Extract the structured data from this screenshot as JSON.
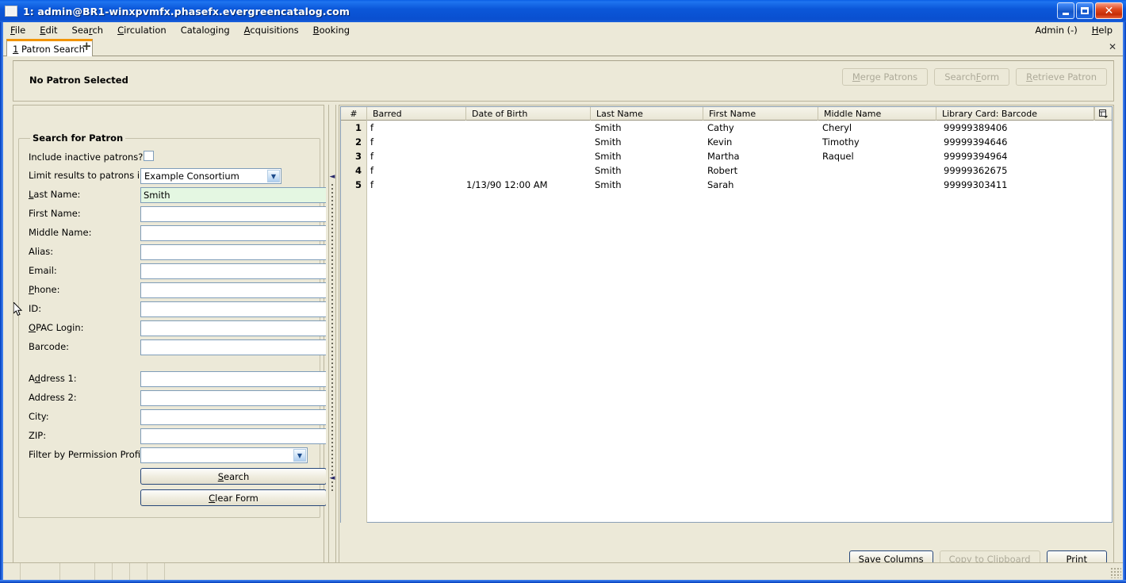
{
  "window": {
    "title": "1: admin@BR1-winxpvmfx.phasefx.evergreencatalog.com",
    "icon": "app-window-icon",
    "buttons": {
      "minimize": "_",
      "maximize": "□",
      "close": "✕"
    }
  },
  "menubar": {
    "items": [
      {
        "label": "File",
        "accel": "F"
      },
      {
        "label": "Edit",
        "accel": "E"
      },
      {
        "label": "Search",
        "accel": "r"
      },
      {
        "label": "Circulation",
        "accel": "C"
      },
      {
        "label": "Cataloging",
        "accel": "g"
      },
      {
        "label": "Acquisitions",
        "accel": "A"
      },
      {
        "label": "Booking",
        "accel": "B"
      }
    ],
    "right": [
      {
        "label": "Admin (-)",
        "accel": ""
      },
      {
        "label": "Help",
        "accel": "H"
      }
    ]
  },
  "tabs": {
    "items": [
      {
        "number": "1",
        "label": "Patron Search",
        "active": true
      }
    ],
    "add_label": "+",
    "close_label": "✕"
  },
  "patron_header": {
    "title": "No Patron Selected",
    "buttons": [
      {
        "label": "Merge Patrons",
        "enabled": false
      },
      {
        "label": "Search Form",
        "enabled": false
      },
      {
        "label": "Retrieve Patron",
        "enabled": false
      }
    ]
  },
  "search_form": {
    "legend": "Search for Patron",
    "fields": [
      {
        "label": "Include inactive patrons?",
        "type": "checkbox",
        "value": "",
        "checked": false
      },
      {
        "label": "Limit results to patrons in",
        "type": "select",
        "value": "Example Consortium"
      },
      {
        "label": "Last Name:",
        "type": "text",
        "value": "Smith",
        "focused": true
      },
      {
        "label": "First Name:",
        "type": "text",
        "value": ""
      },
      {
        "label": "Middle Name:",
        "type": "text",
        "value": ""
      },
      {
        "label": "Alias:",
        "type": "text",
        "value": ""
      },
      {
        "label": "Email:",
        "type": "text",
        "value": ""
      },
      {
        "label": "Phone:",
        "type": "text",
        "value": ""
      },
      {
        "label": "ID:",
        "type": "text",
        "value": ""
      },
      {
        "label": "OPAC Login:",
        "type": "text",
        "value": ""
      },
      {
        "label": "Barcode:",
        "type": "text",
        "value": ""
      },
      {
        "label": "Address 1:",
        "type": "text",
        "value": ""
      },
      {
        "label": "Address 2:",
        "type": "text",
        "value": ""
      },
      {
        "label": "City:",
        "type": "text",
        "value": ""
      },
      {
        "label": "ZIP:",
        "type": "text",
        "value": ""
      },
      {
        "label": "Filter by Permission Profile:",
        "type": "select",
        "value": ""
      }
    ],
    "search_button": "Search",
    "clear_button": "Clear Form"
  },
  "results": {
    "columns": [
      {
        "key": "num",
        "label": "#"
      },
      {
        "key": "barred",
        "label": "Barred"
      },
      {
        "key": "dob",
        "label": "Date of Birth"
      },
      {
        "key": "last",
        "label": "Last Name"
      },
      {
        "key": "first",
        "label": "First Name"
      },
      {
        "key": "middle",
        "label": "Middle Name"
      },
      {
        "key": "barcode",
        "label": "Library Card: Barcode"
      }
    ],
    "rows": [
      {
        "num": "1",
        "barred": "f",
        "dob": "",
        "last": "Smith",
        "first": "Cathy",
        "middle": "Cheryl",
        "barcode": "99999389406"
      },
      {
        "num": "2",
        "barred": "f",
        "dob": "",
        "last": "Smith",
        "first": "Kevin",
        "middle": "Timothy",
        "barcode": "99999394646"
      },
      {
        "num": "3",
        "barred": "f",
        "dob": "",
        "last": "Smith",
        "first": "Martha",
        "middle": "Raquel",
        "barcode": "99999394964"
      },
      {
        "num": "4",
        "barred": "f",
        "dob": "",
        "last": "Smith",
        "first": "Robert",
        "middle": "",
        "barcode": "99999362675"
      },
      {
        "num": "5",
        "barred": "f",
        "dob": "1/13/90 12:00 AM",
        "last": "Smith",
        "first": "Sarah",
        "middle": "",
        "barcode": "99999303411"
      }
    ],
    "column_picker_icon": "column-picker-icon",
    "footer_buttons": [
      {
        "label": "Save Columns",
        "enabled": true
      },
      {
        "label": "Copy to Clipboard",
        "enabled": false
      },
      {
        "label": "Print",
        "enabled": true
      }
    ]
  },
  "statusbar": {
    "cells": [
      "",
      "",
      "",
      "",
      "",
      "",
      "",
      ""
    ]
  }
}
